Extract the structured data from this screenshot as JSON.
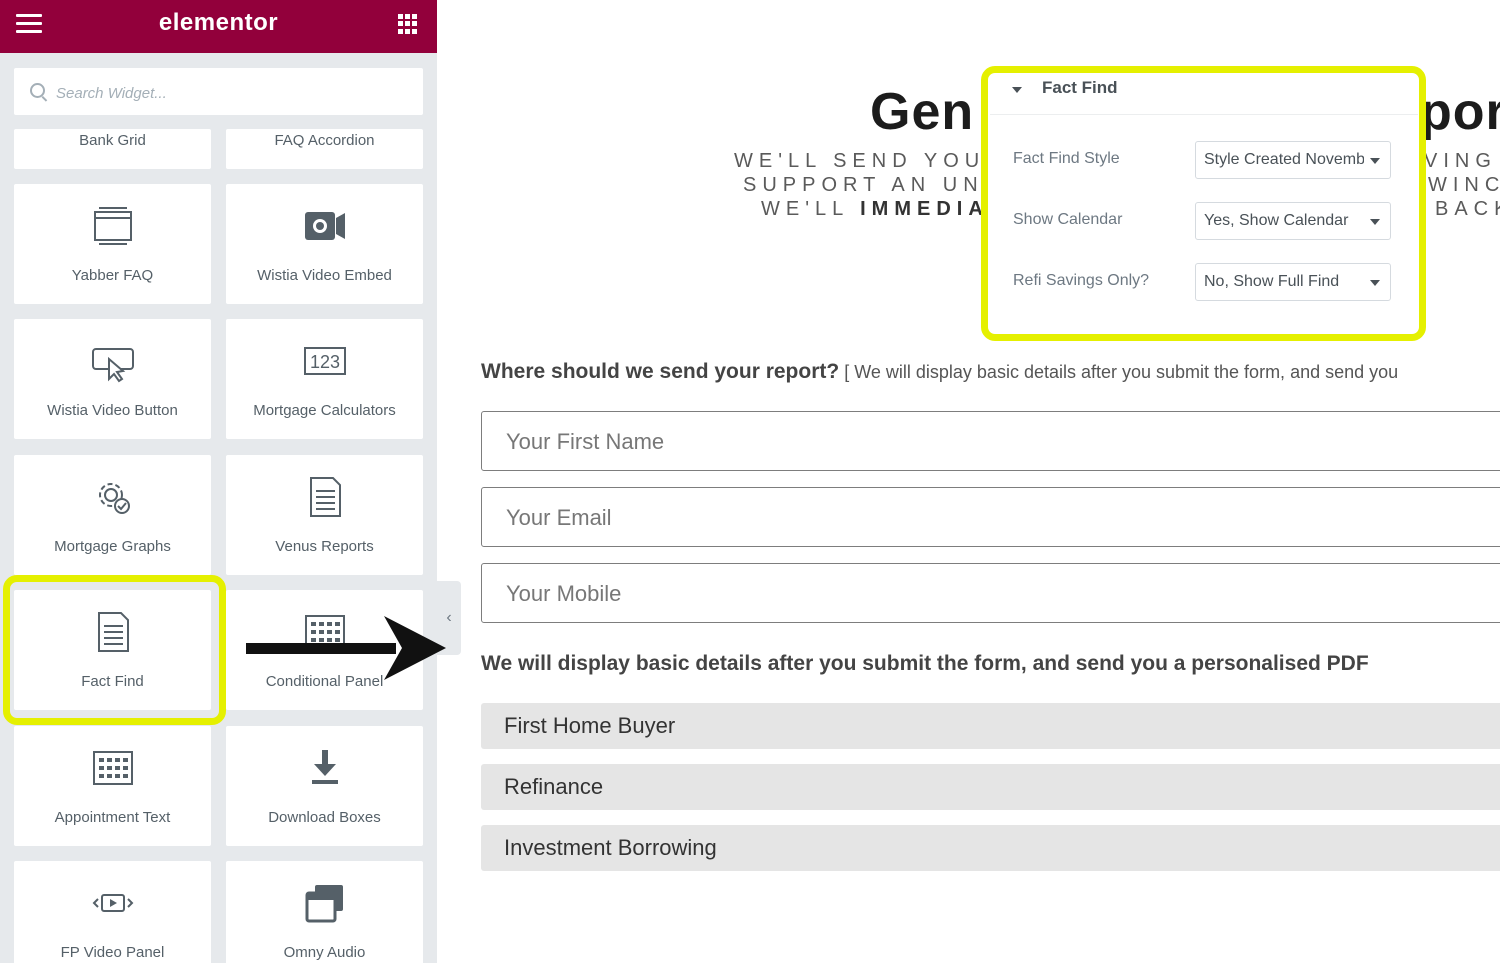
{
  "app": {
    "logo": "elementor",
    "menu_icon": "hamburger-icon",
    "apps_icon": "grid-icon"
  },
  "search": {
    "placeholder": "Search Widget..."
  },
  "widgets": [
    {
      "label": "Bank Grid",
      "icon": "none"
    },
    {
      "label": "FAQ Accordion",
      "icon": "none"
    },
    {
      "label": "Yabber FAQ",
      "icon": "faq-list-icon"
    },
    {
      "label": "Wistia Video Embed",
      "icon": "video-camera-icon"
    },
    {
      "label": "Wistia Video Button",
      "icon": "video-button-icon"
    },
    {
      "label": "Mortgage Calculators",
      "icon": "number-calculator-icon"
    },
    {
      "label": "Mortgage Graphs",
      "icon": "gear-check-icon"
    },
    {
      "label": "Venus Reports",
      "icon": "document-icon"
    },
    {
      "label": "Fact Find",
      "icon": "document-icon"
    },
    {
      "label": "Conditional Panel",
      "icon": "keypad-icon"
    },
    {
      "label": "Appointment Text",
      "icon": "keypad-icon"
    },
    {
      "label": "Download Boxes",
      "icon": "download-icon"
    },
    {
      "label": "FP Video Panel",
      "icon": "video-play-icon"
    },
    {
      "label": "Omny Audio",
      "icon": "stacked-windows-icon"
    }
  ],
  "highlight_color": "#e5f000",
  "brand_color": "#92003b",
  "preview": {
    "heading_left": "Gen",
    "heading_right": "por",
    "subtitle_lines": [
      {
        "left": "WE'LL SEND YOU",
        "right": "VING"
      },
      {
        "left": "SUPPORT AN UN",
        "right": "WINC"
      },
      {
        "left_normal": "WE'LL ",
        "left_bold": "IMMEDIA",
        "right": "BACK"
      }
    ],
    "question_bold": "Where should we send your report?",
    "question_rest": " [ We will display basic details after you submit the form, and send you",
    "fields": [
      {
        "placeholder": "Your First Name"
      },
      {
        "placeholder": "Your Email"
      },
      {
        "placeholder": "Your Mobile"
      }
    ],
    "note": "We will display basic details after you submit the form, and send you a personalised PDF",
    "options": [
      "First Home Buyer",
      "Refinance",
      "Investment Borrowing"
    ],
    "collapse_icon": "chevron-left-icon"
  },
  "popup": {
    "title": "Fact Find",
    "rows": [
      {
        "label": "Fact Find Style",
        "value": "Style Created November"
      },
      {
        "label": "Show Calendar",
        "value": "Yes, Show Calendar"
      },
      {
        "label": "Refi Savings Only?",
        "value": "No, Show Full Find"
      }
    ]
  }
}
